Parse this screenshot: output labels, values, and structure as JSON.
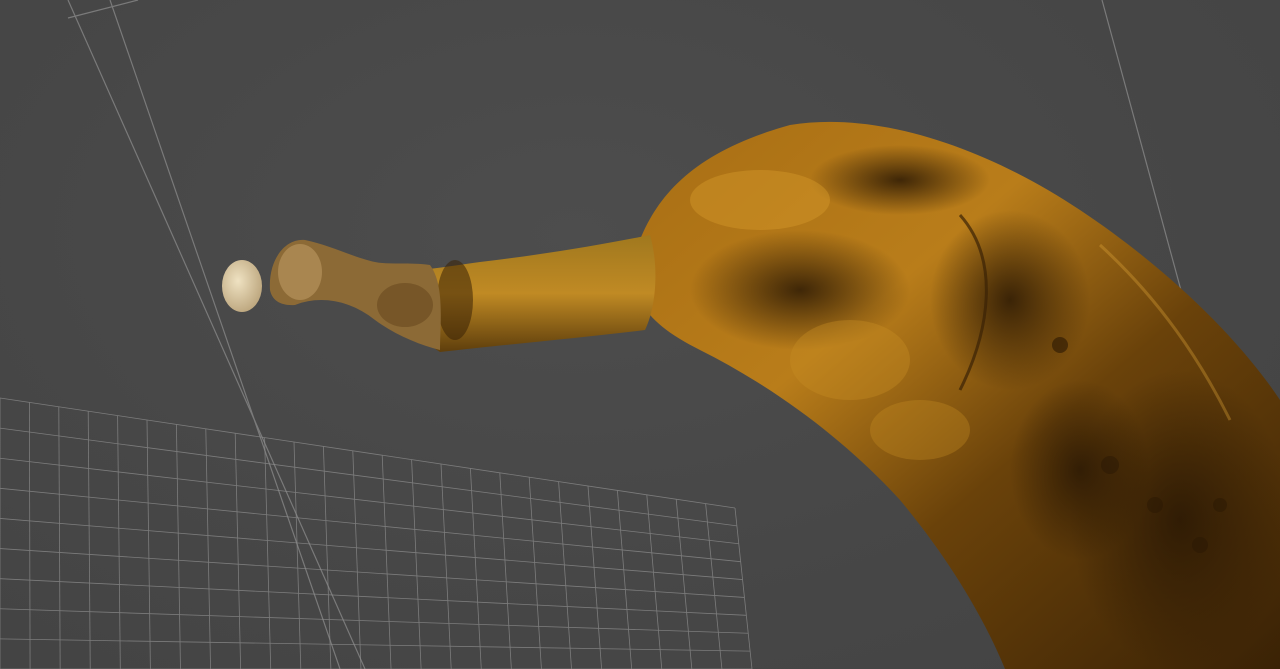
{
  "viewport": {
    "background": "#484848",
    "grid_color": "#8e8e8e",
    "guide_line_color": "#7a7a7a"
  },
  "model": {
    "kind": "scanned 3D mesh",
    "subject": "banana",
    "colors": {
      "peel_light": "#c98f1f",
      "peel_mid": "#9a6410",
      "peel_dark": "#3a2205",
      "stem": "#8a6a35",
      "tip": "#d8c6a0"
    }
  }
}
